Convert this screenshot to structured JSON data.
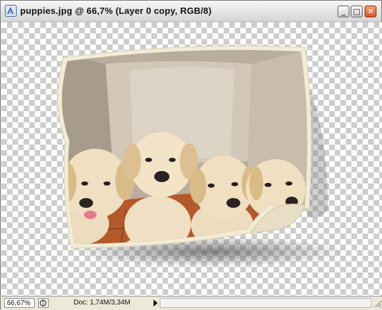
{
  "window": {
    "title": "puppies.jpg @ 66,7% (Layer 0 copy, RGB/8)",
    "minimize_label": "_",
    "maximize_label": "□",
    "close_label": "✕",
    "app_icon": "photoshop-document-icon"
  },
  "canvas": {
    "transparency": "checkerboard",
    "image_subject": "four golden retriever puppies"
  },
  "status_bar": {
    "zoom_value": "66,67%",
    "doc_info": "Doc: 1,74M/3,34M",
    "menu_arrow_icon": "right-triangle-icon"
  },
  "colors": {
    "checker": "#cdcdcd",
    "frame_border": "#f2ecd7",
    "wall": "#b6aa9b",
    "floor": "#b45a2a",
    "fur": "#f0dfc0",
    "close_button": "#d6542c"
  }
}
